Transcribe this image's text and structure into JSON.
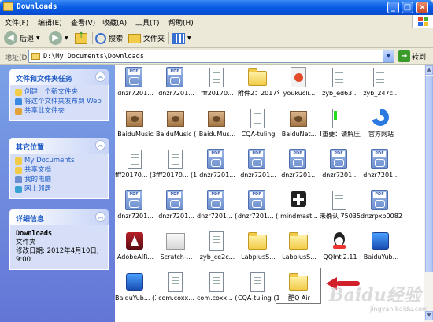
{
  "window": {
    "title": "Downloads"
  },
  "menu": [
    "文件(F)",
    "编辑(E)",
    "查看(V)",
    "收藏(A)",
    "工具(T)",
    "帮助(H)"
  ],
  "toolbar": {
    "back": "后退",
    "search": "搜索",
    "folders": "文件夹"
  },
  "address": {
    "label": "地址(D)",
    "path": "D:\\My Documents\\Downloads",
    "go": "转到"
  },
  "panels": {
    "tasks": {
      "title": "文件和文件夹任务",
      "items": [
        "创建一个新文件夹",
        "将这个文件夹发布到 Web",
        "共享此文件夹"
      ]
    },
    "places": {
      "title": "其它位置",
      "items": [
        "My Documents",
        "共享文档",
        "我的电脑",
        "网上邻居"
      ]
    },
    "details": {
      "title": "详细信息",
      "name": "Downloads",
      "type": "文件夹",
      "modified": "修改日期: 2012年4月10日, 9:00"
    }
  },
  "files": [
    {
      "label": "dnzr7201...",
      "icon": "pdf-icon"
    },
    {
      "label": "dnzr7201...",
      "icon": "pdf-icon"
    },
    {
      "label": "fff20170...",
      "icon": "document-icon"
    },
    {
      "label": "附件2：2017年“和教...",
      "icon": "folder-icon"
    },
    {
      "label": "youkucli...",
      "icon": "video-icon"
    },
    {
      "label": "zyb_ed63...",
      "icon": "document-icon"
    },
    {
      "label": "zyb_247c...",
      "icon": "document-icon"
    },
    {
      "label": "BaiduMusic",
      "icon": "package-icon"
    },
    {
      "label": "BaiduMusic (1)",
      "icon": "package-icon"
    },
    {
      "label": "BaiduMus...",
      "icon": "package-icon"
    },
    {
      "label": "CQA-tuling",
      "icon": "document-icon"
    },
    {
      "label": "BaiduNet...",
      "icon": "package-icon"
    },
    {
      "label": "!重要：请解压后再使用",
      "icon": "warning-doc-icon"
    },
    {
      "label": "官方网站",
      "icon": "browser-icon"
    },
    {
      "label": "fff20170... (3)",
      "icon": "document-icon"
    },
    {
      "label": "fff20170... (1)",
      "icon": "document-icon"
    },
    {
      "label": "dnzr7201...",
      "icon": "pdf-icon"
    },
    {
      "label": "dnzr7201...",
      "icon": "pdf-icon"
    },
    {
      "label": "dnzr7201...",
      "icon": "pdf-icon"
    },
    {
      "label": "dnzr7201...",
      "icon": "pdf-icon"
    },
    {
      "label": "dnzr7201...",
      "icon": "pdf-icon"
    },
    {
      "label": "dnzr7201...",
      "icon": "pdf-icon"
    },
    {
      "label": "dnzr7201...",
      "icon": "pdf-icon"
    },
    {
      "label": "dnzr7201... (2)",
      "icon": "pdf-icon"
    },
    {
      "label": "dnzr7201... (3)",
      "icon": "pdf-icon"
    },
    {
      "label": "mindmast...",
      "icon": "mindmap-icon"
    },
    {
      "label": "未确认 750353.c...",
      "icon": "document-icon"
    },
    {
      "label": "dnzrpxb0082",
      "icon": "pdf-icon"
    },
    {
      "label": "AdobeAIR...",
      "icon": "adobe-air-icon"
    },
    {
      "label": "Scratch-...",
      "icon": "box-icon"
    },
    {
      "label": "zyb_ce2c...",
      "icon": "document-icon"
    },
    {
      "label": "LabplusS...",
      "icon": "folder-icon"
    },
    {
      "label": "LabplusS...",
      "icon": "folder-icon"
    },
    {
      "label": "QQIntl2.11",
      "icon": "qq-icon"
    },
    {
      "label": "BaiduYub...",
      "icon": "blue-app-icon"
    },
    {
      "label": "BaiduYub... (1)",
      "icon": "blue-app-icon"
    },
    {
      "label": "com.coxx...",
      "icon": "document-icon"
    },
    {
      "label": "com.coxx... (1).cpk",
      "icon": "document-icon"
    },
    {
      "label": "CQA-tuling (1)",
      "icon": "document-icon"
    },
    {
      "label": "酷Q Air",
      "icon": "folder-icon"
    }
  ],
  "watermark": {
    "text": "Baidu经验",
    "sub": "jingyan.baidu.com"
  }
}
